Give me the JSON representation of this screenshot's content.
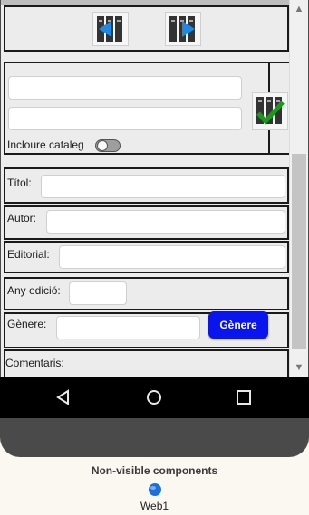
{
  "form": {
    "include_label": "Incloure\ncataleg",
    "fields": [
      {
        "label": "Títol:",
        "value": ""
      },
      {
        "label": "Autor:",
        "value": ""
      },
      {
        "label": "Editorial:",
        "value": ""
      },
      {
        "label": "Any edició:",
        "value": ""
      },
      {
        "label": "Gènere:",
        "value": ""
      },
      {
        "label": "Comentaris:",
        "value": ""
      }
    ],
    "genre_button": "Gènere"
  },
  "search": {
    "input1": "",
    "input2": ""
  },
  "colors": {
    "accent_button": "#0a14ee",
    "check": "#1a9a1a",
    "arrow": "#1e88e5"
  },
  "footer": {
    "title": "Non-visible components",
    "component": "Web1"
  }
}
